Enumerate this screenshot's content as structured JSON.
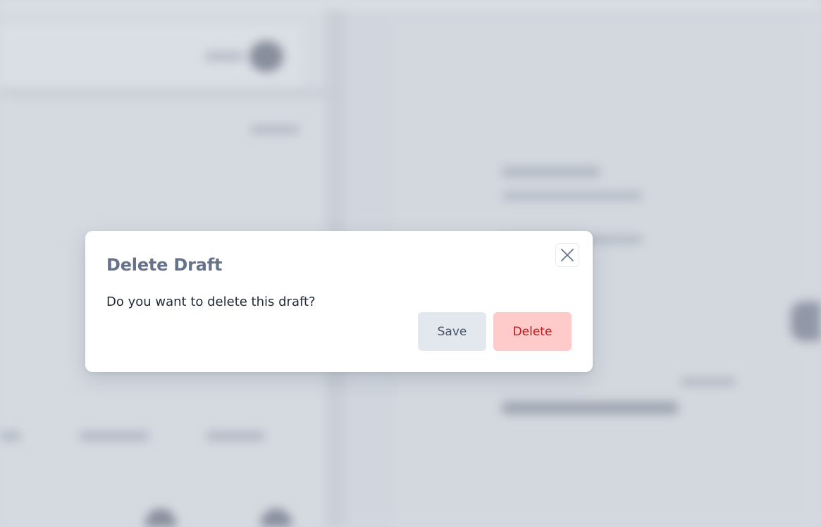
{
  "dialog": {
    "title": "Delete Draft",
    "message": "Do you want to delete this draft?",
    "close_icon": "close-icon",
    "buttons": {
      "save_label": "Save",
      "delete_label": "Delete"
    }
  },
  "colors": {
    "title": "#65728a",
    "save_bg": "#e3e8ef",
    "save_text": "#475569",
    "delete_bg": "#fecaca",
    "delete_text": "#b91c1c"
  }
}
